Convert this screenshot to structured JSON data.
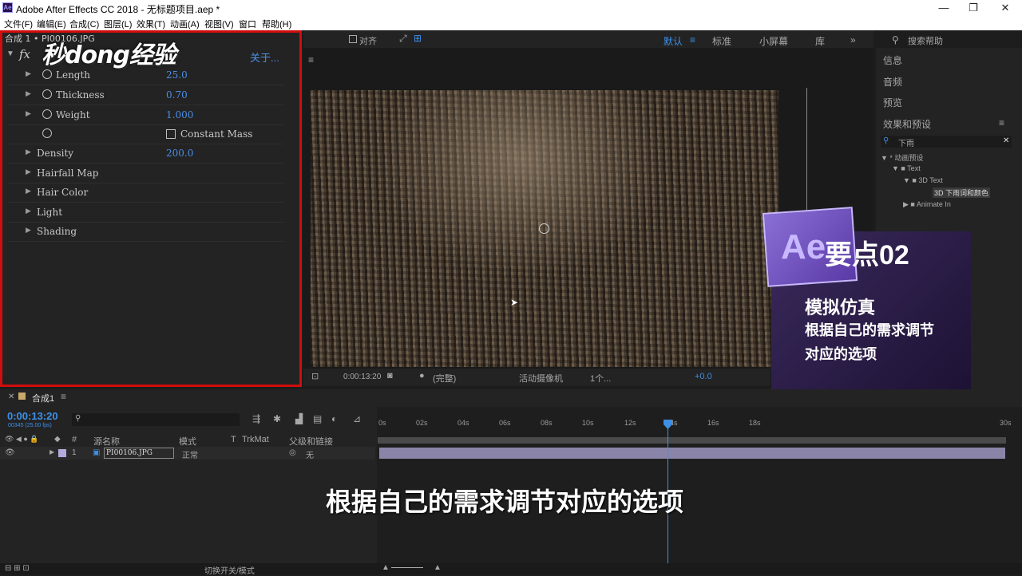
{
  "window": {
    "title": "Adobe After Effects CC 2018 - 无标题项目.aep *",
    "minimize": "—",
    "maximize": "❐",
    "close": "✕"
  },
  "menu": [
    "文件(F)",
    "编辑(E)",
    "合成(C)",
    "图层(L)",
    "效果(T)",
    "动画(A)",
    "视图(V)",
    "窗口",
    "帮助(H)"
  ],
  "effect_controls": {
    "header": "合成 1 • PI00106.JPG",
    "about": "关于...",
    "logo_text": "秒dong经验",
    "rows": [
      {
        "name": "Length",
        "value": "25.0",
        "stopwatch": true,
        "expand": true
      },
      {
        "name": "Thickness",
        "value": "0.70",
        "stopwatch": true,
        "expand": true
      },
      {
        "name": "Weight",
        "value": "1.000",
        "stopwatch": true,
        "expand": true
      },
      {
        "name": "Constant Mass",
        "value": "",
        "stopwatch": true,
        "checkbox": true
      },
      {
        "name": "Density",
        "value": "200.0",
        "expand": true
      },
      {
        "name": "Hairfall Map",
        "value": "",
        "expand": true
      },
      {
        "name": "Hair Color",
        "value": "",
        "expand": true
      },
      {
        "name": "Light",
        "value": "",
        "expand": true
      },
      {
        "name": "Shading",
        "value": "",
        "expand": true
      }
    ]
  },
  "toolbar": {
    "align_label": "对齐",
    "workspaces": [
      "默认",
      "标准",
      "小屏幕",
      "库"
    ],
    "search_help": "搜索帮助"
  },
  "right_panel": {
    "items": [
      "信息",
      "音频",
      "预览",
      "效果和预设"
    ],
    "search_value": "下雨",
    "tree": [
      "▼ * 动画预设",
      "▼ ■ Text",
      "▼ ■ 3D Text",
      "3D 下雨词和颜色",
      "▶ ■ Animate In"
    ]
  },
  "viewer_bar": {
    "timecode": "0:00:13:20",
    "resolution": "(完整)",
    "camera": "活动摄像机",
    "views": "1个...",
    "exposure": "+0.0"
  },
  "overlay_card": {
    "badge": "Ae",
    "title": "要点02",
    "line1": "模拟仿真",
    "line2": "根据自己的需求调节",
    "line3": "对应的选项"
  },
  "timeline": {
    "tab": "合成1",
    "timecode": "0:00:13:20",
    "fps": "00345 (25.00 fps)",
    "columns": [
      "#",
      "源名称",
      "模式",
      "T",
      "TrkMat",
      "父级和链接"
    ],
    "ruler": [
      "0s",
      "02s",
      "04s",
      "06s",
      "08s",
      "10s",
      "12s",
      "14s",
      "16s",
      "18s",
      "30s"
    ],
    "layer": {
      "num": "1",
      "name": "PI00106.JPG",
      "mode": "正常",
      "parent": "无"
    },
    "toggle_label": "切换开关/模式"
  },
  "subtitle": "根据自己的需求调节对应的选项"
}
